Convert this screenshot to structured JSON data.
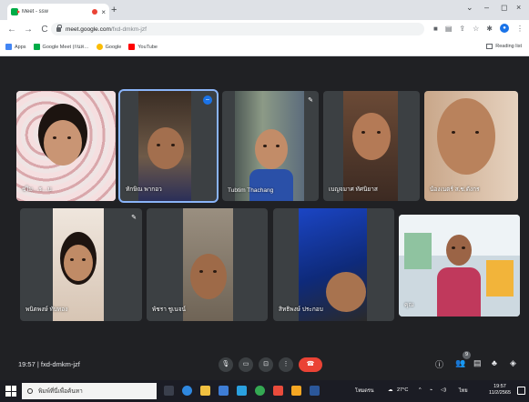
{
  "browser": {
    "tab_title": "Meet - ssw",
    "tab_close": "×",
    "new_tab": "+",
    "win_minimize": "–",
    "win_restore": "◻",
    "win_close": "×",
    "url_host": "meet.google.com",
    "url_path": "/fxd-dmkm-jzf",
    "back": "←",
    "forward": "→",
    "reload": "C"
  },
  "bookmarks": {
    "apps": "Apps",
    "items": [
      "Google Meet (กนห…",
      "Google",
      "YouTube"
    ],
    "reading_list": "Reading list"
  },
  "participants": [
    {
      "name": "ชไม…ร…บ"
    },
    {
      "name": "ทักษิณ พากอว"
    },
    {
      "name": "Tubtim Thachang"
    },
    {
      "name": "เบญจมาศ ทัศนิยาส"
    },
    {
      "name": "น้องเนตร์ ส.ช.ดังกร"
    },
    {
      "name": "พนิตพงษ์ ทับทอง"
    },
    {
      "name": "พัชรา ชูเนจน์"
    },
    {
      "name": "สิทธิพงษ์ ประกอบ"
    },
    {
      "name": "คุณ"
    }
  ],
  "meet": {
    "time": "19:57",
    "code": "fxd-dmkm-jzf",
    "participants_count": "9"
  },
  "taskbar": {
    "search_placeholder": "พิมพ์ที่นี่เพื่อค้นหา",
    "temperature": "27°C",
    "language": "ไทย",
    "clock_time": "19:57",
    "clock_date": "11/2/2565",
    "weather": "โหมดรน"
  },
  "colors": {
    "meet_bg": "#202124",
    "end_call": "#ea4335",
    "active_outline": "#8ab4f8"
  }
}
